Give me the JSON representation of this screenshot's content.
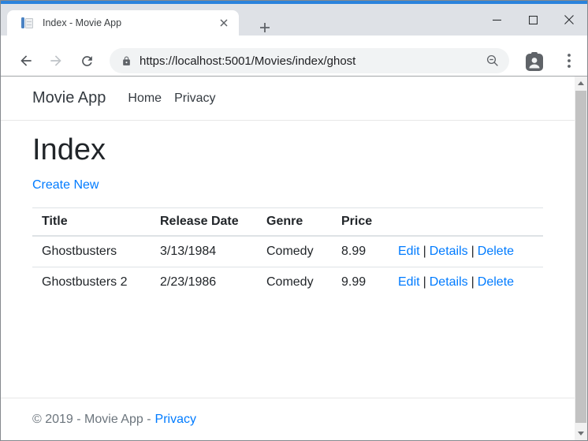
{
  "window": {
    "tab_title": "Index - Movie App",
    "icons": {
      "favicon": "document-with-blue-bar",
      "tab_close": "x-glyph",
      "new_tab": "plus-glyph",
      "minimize": "horizontal-line",
      "maximize": "square-outline",
      "close": "x-glyph",
      "back": "left-arrow",
      "forward": "right-arrow",
      "reload": "circular-arrow",
      "lock": "padlock",
      "zoom_indicator": "magnifier-minus",
      "profile": "person-badge",
      "menu": "vertical-ellipsis",
      "scroll_up": "triangle-up",
      "scroll_down": "triangle-down"
    }
  },
  "browser": {
    "url": "https://localhost:5001/Movies/index/ghost"
  },
  "page": {
    "navbar": {
      "brand": "Movie App",
      "links": [
        {
          "label": "Home"
        },
        {
          "label": "Privacy"
        }
      ]
    },
    "heading": "Index",
    "create_new_label": "Create New",
    "table": {
      "headers": [
        "Title",
        "Release Date",
        "Genre",
        "Price"
      ],
      "action_separator": "|",
      "rows": [
        {
          "title": "Ghostbusters",
          "release_date": "3/13/1984",
          "genre": "Comedy",
          "price": "8.99",
          "actions": [
            "Edit",
            "Details",
            "Delete"
          ]
        },
        {
          "title": "Ghostbusters 2",
          "release_date": "2/23/1986",
          "genre": "Comedy",
          "price": "9.99",
          "actions": [
            "Edit",
            "Details",
            "Delete"
          ]
        }
      ]
    },
    "footer": {
      "copyright": "© 2019 - Movie App -",
      "privacy_label": "Privacy"
    }
  },
  "colors": {
    "accent_strip": "#2B83DC",
    "link_blue": "#007BFF",
    "text_dark": "#212529",
    "muted": "#6C757D",
    "table_border": "#DEE2E6"
  }
}
